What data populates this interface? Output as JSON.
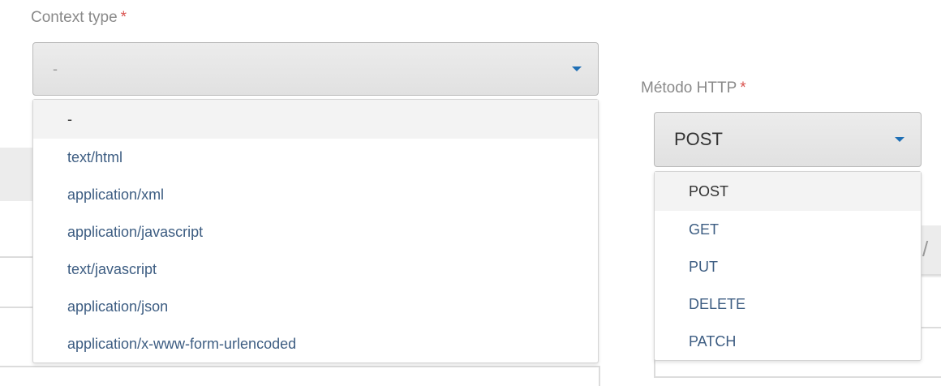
{
  "context": {
    "label": "Context type",
    "required_mark": "*",
    "selected_value": "-",
    "options": [
      "-",
      "text/html",
      "application/xml",
      "application/javascript",
      "text/javascript",
      "application/json",
      "application/x-www-form-urlencoded"
    ]
  },
  "http": {
    "label": "Método HTTP",
    "required_mark": "*",
    "selected_value": "POST",
    "options": [
      "POST",
      "GET",
      "PUT",
      "DELETE",
      "PATCH"
    ]
  },
  "background": {
    "partial_glyph": "/"
  },
  "colors": {
    "caret": "#1f6fb5",
    "option_text": "#3d5d82",
    "required": "#d9534f"
  }
}
